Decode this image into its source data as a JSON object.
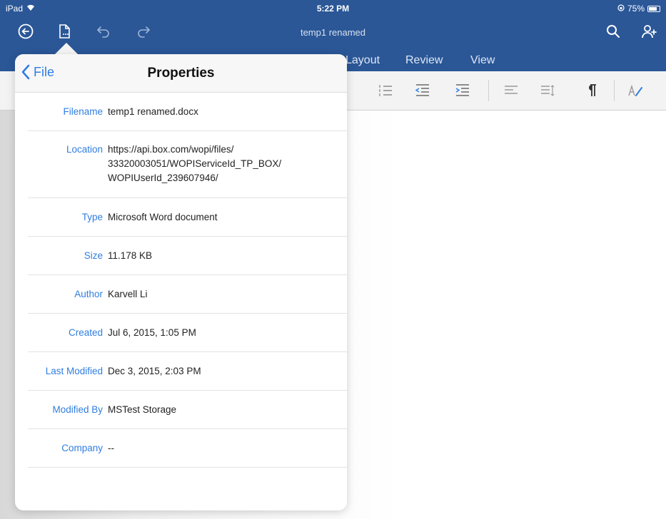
{
  "status_bar": {
    "device": "iPad",
    "time": "5:22 PM",
    "battery": "75%"
  },
  "app": {
    "document_title": "temp1 renamed",
    "icons": [
      "back-circle-icon",
      "file-icon",
      "undo-icon",
      "redo-icon",
      "search-icon",
      "add-person-icon"
    ]
  },
  "ribbon": {
    "tabs": [
      "Layout",
      "Review",
      "View"
    ]
  },
  "popover": {
    "back_label": "File",
    "title": "Properties",
    "rows": [
      {
        "label": "Filename",
        "value": "temp1 renamed.docx"
      },
      {
        "label": "Location",
        "value": "https://api.box.com/wopi/files/\n33320003051/WOPIServiceId_TP_BOX/\nWOPIUserId_239607946/"
      },
      {
        "label": "Type",
        "value": "Microsoft Word document"
      },
      {
        "label": "Size",
        "value": "11.178 KB"
      },
      {
        "label": "Author",
        "value": "Karvell Li"
      },
      {
        "label": "Created",
        "value": "Jul 6, 2015, 1:05 PM"
      },
      {
        "label": "Last Modified",
        "value": "Dec 3, 2015, 2:03 PM"
      },
      {
        "label": "Modified By",
        "value": "MSTest Storage"
      },
      {
        "label": "Company",
        "value": "--"
      }
    ]
  },
  "colors": {
    "title_bar": "#2b5797",
    "accent_link": "#2f7de1"
  }
}
